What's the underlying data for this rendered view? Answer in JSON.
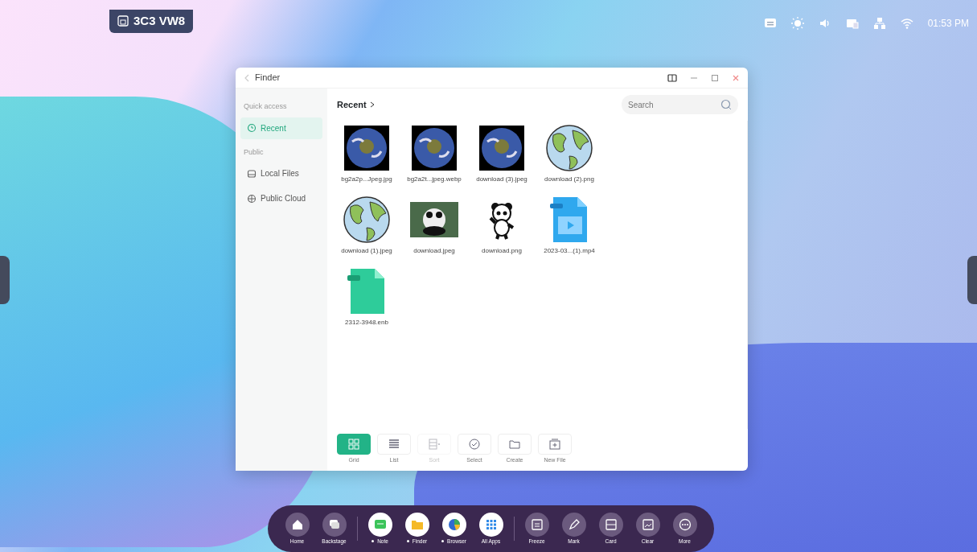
{
  "room_badge": {
    "text": "3C3 VW8"
  },
  "status_bar": {
    "time": "01:53 PM"
  },
  "window": {
    "title": "Finder"
  },
  "sidebar": {
    "sections": [
      {
        "heading": "Quick access",
        "items": [
          {
            "label": "Recent",
            "selected": true,
            "kind": "clock"
          }
        ]
      },
      {
        "heading": "Public",
        "items": [
          {
            "label": "Local Files",
            "selected": false,
            "kind": "drive"
          },
          {
            "label": "Public Cloud",
            "selected": false,
            "kind": "cloud"
          }
        ]
      }
    ]
  },
  "breadcrumb": "Recent",
  "search": {
    "placeholder": "Search"
  },
  "files": [
    {
      "name": "bg2a2p...Jpeg.jpg",
      "kind": "earth-photo"
    },
    {
      "name": "bg2a2t...jpeg.webp",
      "kind": "earth-photo"
    },
    {
      "name": "download (3).jpeg",
      "kind": "earth-photo"
    },
    {
      "name": "download (2).png",
      "kind": "globe"
    },
    {
      "name": "download (1).jpeg",
      "kind": "globe"
    },
    {
      "name": "download.jpeg",
      "kind": "panda-photo"
    },
    {
      "name": "download.png",
      "kind": "panda"
    },
    {
      "name": "2023-03...(1).mp4",
      "kind": "video-file"
    },
    {
      "name": "2312-3948.enb",
      "kind": "enb-file"
    }
  ],
  "toolbar": [
    {
      "label": "Grid",
      "kind": "grid",
      "selected": true,
      "disabled": false
    },
    {
      "label": "List",
      "kind": "list",
      "selected": false,
      "disabled": false
    },
    {
      "label": "Sort",
      "kind": "sort",
      "selected": false,
      "disabled": true
    },
    {
      "label": "Select",
      "kind": "select",
      "selected": false,
      "disabled": false
    },
    {
      "label": "Create",
      "kind": "folder",
      "selected": false,
      "disabled": false
    },
    {
      "label": "New File",
      "kind": "newfile",
      "selected": false,
      "disabled": false
    }
  ],
  "dock": [
    {
      "label": "Home",
      "kind": "home",
      "running": false
    },
    {
      "label": "Backstage",
      "kind": "backstage",
      "running": false
    },
    {
      "label": "Note",
      "kind": "note",
      "running": true
    },
    {
      "label": "Finder",
      "kind": "finder",
      "running": true
    },
    {
      "label": "Browser",
      "kind": "browser",
      "running": true
    },
    {
      "label": "All Apps",
      "kind": "apps",
      "running": false
    },
    {
      "label": "Freeze",
      "kind": "freeze",
      "running": false
    },
    {
      "label": "Mark",
      "kind": "mark",
      "running": false
    },
    {
      "label": "Card",
      "kind": "card",
      "running": false
    },
    {
      "label": "Clear",
      "kind": "clear",
      "running": false
    },
    {
      "label": "More",
      "kind": "more",
      "running": false
    }
  ]
}
